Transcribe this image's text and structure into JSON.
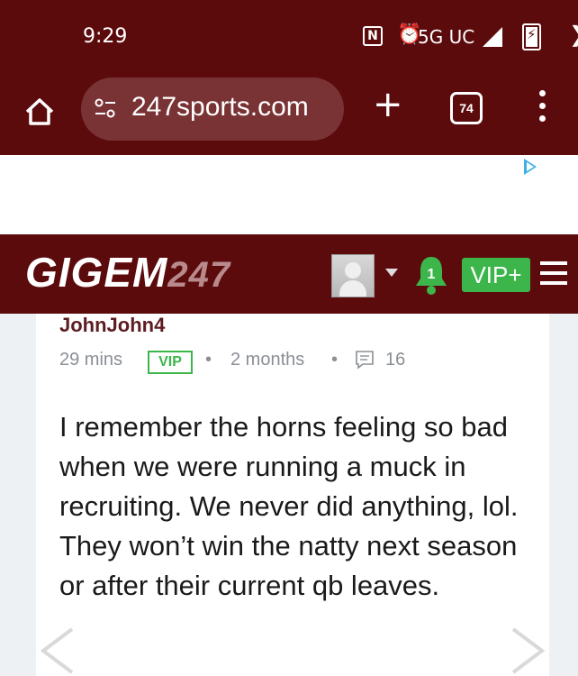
{
  "status_bar": {
    "time": "9:29",
    "nfc_label": "N",
    "alarm_glyph": "⏰",
    "network": "5G UC",
    "bolt": "⚡",
    "edge": "❯"
  },
  "browser": {
    "url": "247sports.com",
    "new_tab_glyph": "+",
    "tab_count": "74"
  },
  "site": {
    "logo_text": "GIGEM",
    "logo_number": "247",
    "notification_count": "1",
    "vip_button": "VIP+"
  },
  "post": {
    "author": "JohnJohn4",
    "time_ago": "29 mins",
    "badge": "VIP",
    "separator": "•",
    "tenure": "2 months",
    "comment_count": "16",
    "body": "I remember the horns feeling so bad when we were running a muck in recruiting. We never did anything, lol. They won’t win the natty next season or after their current qb leaves."
  },
  "colors": {
    "maroon": "#5c0b0d",
    "vip_green": "#3cb64a",
    "author": "#5c1d22"
  }
}
